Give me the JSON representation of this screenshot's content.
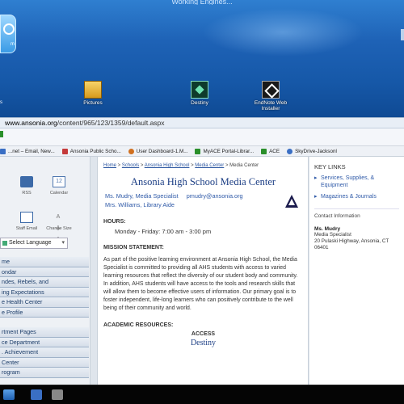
{
  "desktop": {
    "top_banner": "Working Engines...",
    "big_icon_label": "m",
    "icons": [
      {
        "label": "Pictures",
        "icon": "folder-icon"
      },
      {
        "label": "Destiny",
        "icon": "destiny-icon"
      },
      {
        "label": "EndNote Web Installer",
        "icon": "endnote-icon"
      }
    ],
    "left_text": "s"
  },
  "browser": {
    "url_prefix": "www.ansonia.org",
    "url_path": "/content/965/123/1359/default.aspx",
    "favorites": [
      {
        "label": "...net – Email, New...",
        "color": "#3a6fc4"
      },
      {
        "label": "Ansonia Public Scho...",
        "color": "#c43a3a"
      },
      {
        "label": "User Dashboard-1.M...",
        "color": "#d07020"
      },
      {
        "label": "MyACE Portal-Librar...",
        "color": "#2a8f2a"
      },
      {
        "label": "ACE",
        "color": "#2a8f2a"
      },
      {
        "label": "SkyDrive-Jacksonl",
        "color": "#3a6fc4"
      }
    ]
  },
  "leftnav": {
    "quick": [
      {
        "label": "RSS"
      },
      {
        "label": "Calendar",
        "glyph": "12"
      },
      {
        "label": "Staff Email"
      },
      {
        "label": "Change Size",
        "glyph": "A A A"
      }
    ],
    "language": "Select Language",
    "menu": [
      "me",
      "ondar",
      "ndes, Rebels, and",
      "ing Expectations",
      "e Health Center",
      "e Profile",
      "rtment Pages",
      "ce Department",
      ". Achievement",
      "Center",
      "rogram"
    ]
  },
  "main": {
    "breadcrumb": {
      "home": "Home",
      "schools": "Schools",
      "high_school": "Ansonia High School",
      "media": "Media Center",
      "current": "Media Center"
    },
    "title": "Ansonia High School Media Center",
    "staff_1": "Ms. Mudry, Media Specialist",
    "staff_email": "pmudry@ansonia.org",
    "staff_2": "Mrs. Williams, Library Aide",
    "hours_heading": "HOURS:",
    "hours": "Monday - Friday: 7:00 am - 3:00 pm",
    "mission_heading": "MISSION STATEMENT:",
    "mission": "As part of the positive learning environment at Ansonia High School, the Media Specialist is committed to providing all AHS students with access to varied learning resources that reflect the diversity of our student body and community.  In addition, AHS students will have access to the tools and research skills that will allow them to become effective users of information.  Our primary goal is to foster independent, life-long learners who can positively contribute to the well being of their community and world.",
    "resources_heading": "ACADEMIC RESOURCES:",
    "access": "ACCESS",
    "destiny": "Destiny"
  },
  "right": {
    "key_links": "KEY LINKS",
    "links": [
      "Services, Supplies, & Equipment",
      "Magazines & Journals"
    ],
    "contact_heading": "Contact Information",
    "contact_name": "Ms. Mudry",
    "contact_title": "Media Specialist",
    "contact_address": "20 Pulaski Highway, Ansonia, CT 06401"
  }
}
